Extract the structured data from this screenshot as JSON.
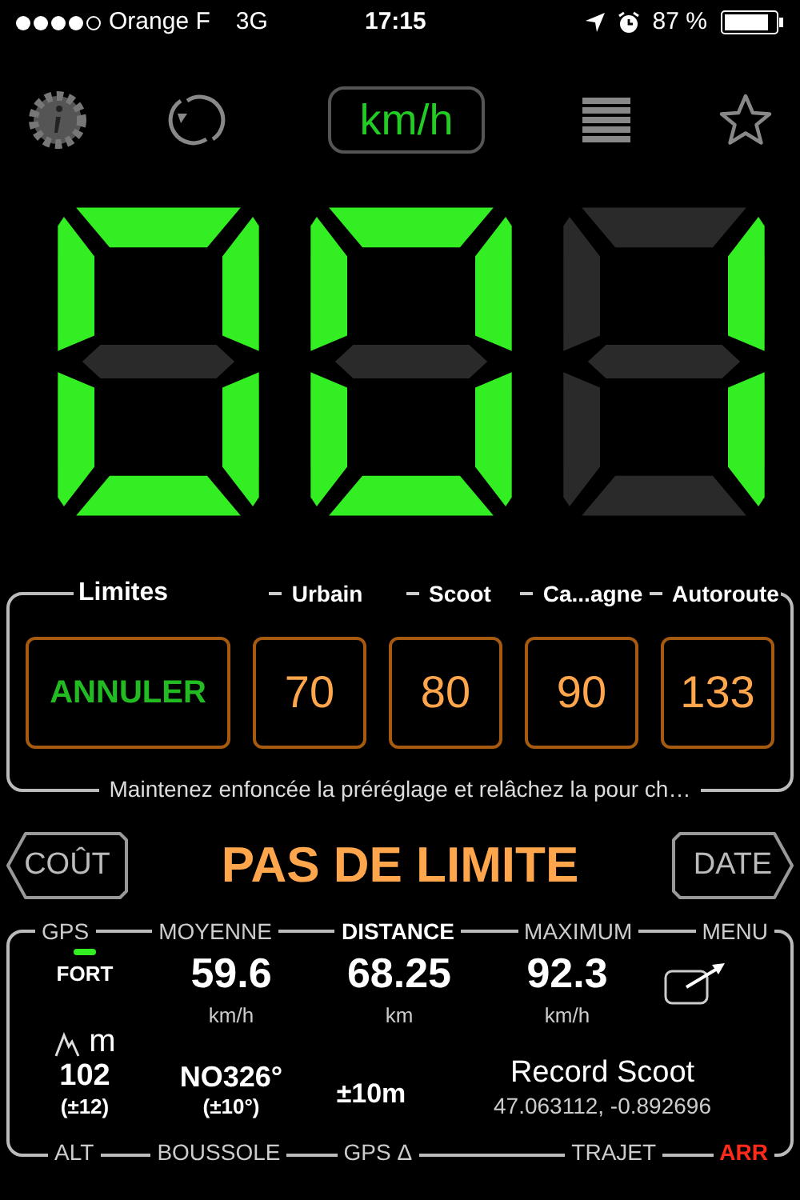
{
  "status_bar": {
    "carrier": "Orange F",
    "network": "3G",
    "time": "17:15",
    "battery": "87 %"
  },
  "toolbar": {
    "unit": "km/h"
  },
  "speed": {
    "digits": [
      {
        "top": true,
        "top_right": true,
        "bottom_right": true,
        "bottom": true,
        "bottom_left": true,
        "top_left": true,
        "middle": false
      },
      {
        "top": true,
        "top_right": true,
        "bottom_right": true,
        "bottom": true,
        "bottom_left": true,
        "top_left": true,
        "middle": false
      },
      {
        "top": false,
        "top_right": true,
        "bottom_right": true,
        "bottom": false,
        "bottom_left": false,
        "top_left": false,
        "middle": false
      }
    ]
  },
  "limits": {
    "title": "Limites",
    "categories": [
      "Urbain",
      "Scoot",
      "Ca...agne",
      "Autoroute"
    ],
    "buttons": [
      {
        "kind": "cancel",
        "label": "ANNULER"
      },
      {
        "kind": "preset",
        "label": "70"
      },
      {
        "kind": "preset",
        "label": "80"
      },
      {
        "kind": "preset",
        "label": "90"
      },
      {
        "kind": "preset",
        "label": "133"
      }
    ],
    "hint": "Maintenez enfoncée la préréglage et relâchez la pour ch…"
  },
  "limit_bar": {
    "left": "COÛT",
    "status": "PAS DE LIMITE",
    "right": "DATE"
  },
  "stats": {
    "top_labels": [
      {
        "label": "GPS",
        "kind": "normal"
      },
      {
        "label": "MOYENNE",
        "kind": "normal"
      },
      {
        "label": "DISTANCE",
        "kind": "bold"
      },
      {
        "label": "MAXIMUM",
        "kind": "normal"
      },
      {
        "label": "MENU",
        "kind": "normal"
      }
    ],
    "gps_strength": "FORT",
    "values": [
      {
        "value": "59.6",
        "unit": "km/h"
      },
      {
        "value": "68.25",
        "unit": "km"
      },
      {
        "value": "92.3",
        "unit": "km/h"
      }
    ],
    "altitude_unit": "m",
    "altitude": "102",
    "altitude_error": "(±12)",
    "heading": "NO326°",
    "heading_error": "(±10°)",
    "gps_error": "±10m",
    "record_title": "Record Scoot",
    "coordinates": "47.063112, -0.892696",
    "bottom_labels": [
      {
        "label": "ALT",
        "kind": "normal"
      },
      {
        "label": "BOUSSOLE",
        "kind": "normal"
      },
      {
        "label": "GPS Δ",
        "kind": "normal"
      },
      {
        "label": "TRAJET",
        "kind": "normal"
      },
      {
        "label": "ARR",
        "kind": "alert"
      }
    ]
  }
}
